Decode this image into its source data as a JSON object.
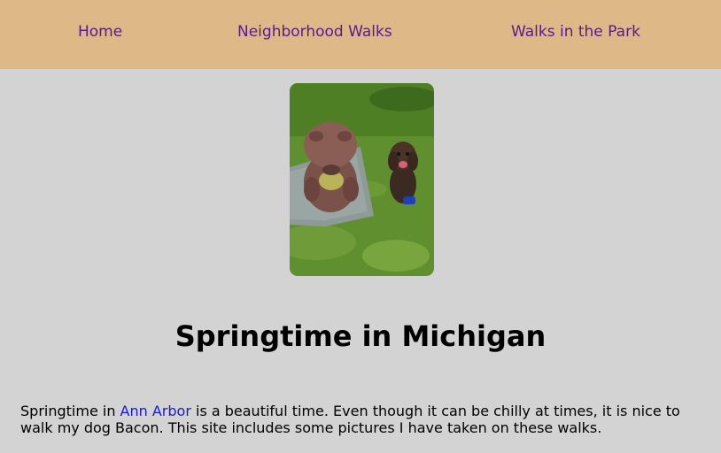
{
  "nav": {
    "items": [
      {
        "label": "Home"
      },
      {
        "label": "Neighborhood Walks"
      },
      {
        "label": "Walks in the Park"
      }
    ]
  },
  "hero_image": {
    "alt": "Dog sitting next to a beaver statue on grass"
  },
  "main": {
    "title": "Springtime in Michigan",
    "intro": {
      "before_link": "Springtime in ",
      "link_text": "Ann Arbor",
      "after_link": " is a beautiful time. Even though it can be chilly at times, it is nice to walk my dog Bacon. This site includes some pictures I have taken on these walks."
    }
  },
  "colors": {
    "nav_background": "#deb887",
    "page_background": "#d3d3d3",
    "nav_link": "#5b1a8b",
    "body_link": "#1a1ad6"
  }
}
